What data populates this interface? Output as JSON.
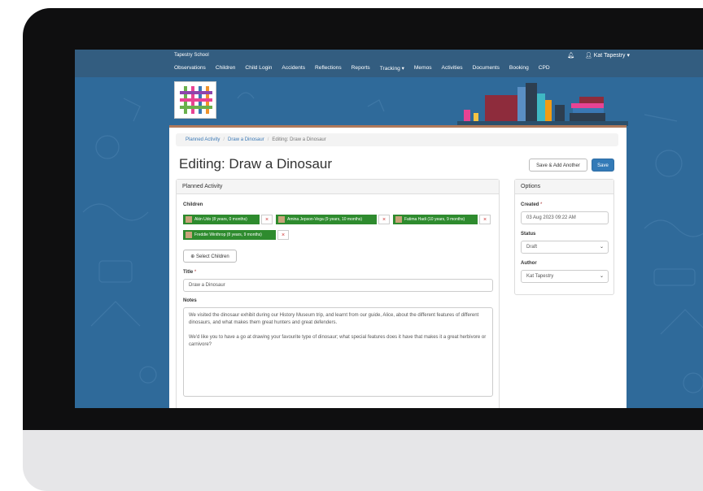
{
  "school_name": "Tapestry School",
  "user": {
    "name": "Kat Tapestry",
    "caret": "▾"
  },
  "nav": [
    "Observations",
    "Children",
    "Child Login",
    "Accidents",
    "Reflections",
    "Reports",
    "Tracking ▾",
    "Memos",
    "Activities",
    "Documents",
    "Booking",
    "CPD"
  ],
  "breadcrumb": {
    "root": "Planned Activity",
    "parent": "Draw a Dinosaur",
    "current": "Editing: Draw a Dinosaur"
  },
  "page_title": "Editing: Draw a Dinosaur",
  "buttons": {
    "save_add_another": "Save & Add Another",
    "save": "Save",
    "select_children": "Select Children"
  },
  "planned_panel": {
    "heading": "Planned Activity",
    "children_label": "Children",
    "children": [
      "Akin Udo (8 years, 0 months)",
      "Amina Jepson-Vega (9 years, 10 months)",
      "Fatima Hadi (10 years, 9 months)",
      "Freddie Winthrop (8 years, 9 months)"
    ],
    "remove_symbol": "×",
    "title_label": "Title",
    "required_mark": "*",
    "title_value": "Draw a Dinosaur",
    "notes_label": "Notes",
    "notes": [
      "We visited the dinosaur exhibit during our History Museum trip, and learnt from our guide, Alice, about the different features of different dinosaurs, and what makes them great hunters and great defenders.",
      "We'd like you to have a go at drawing your favourite type of dinosaur; what special features does it have that makes it a great herbivore or carnivore?"
    ]
  },
  "options_panel": {
    "heading": "Options",
    "created_label": "Created",
    "created_value": "03 Aug 2023 09:22 AM",
    "status_label": "Status",
    "status_value": "Draft",
    "author_label": "Author",
    "author_value": "Kat Tapestry"
  },
  "colors": {
    "accent": "#337ab7",
    "chip": "#2e8b2e",
    "nav_bg": "#335d80",
    "bg": "#2f6a9a"
  }
}
